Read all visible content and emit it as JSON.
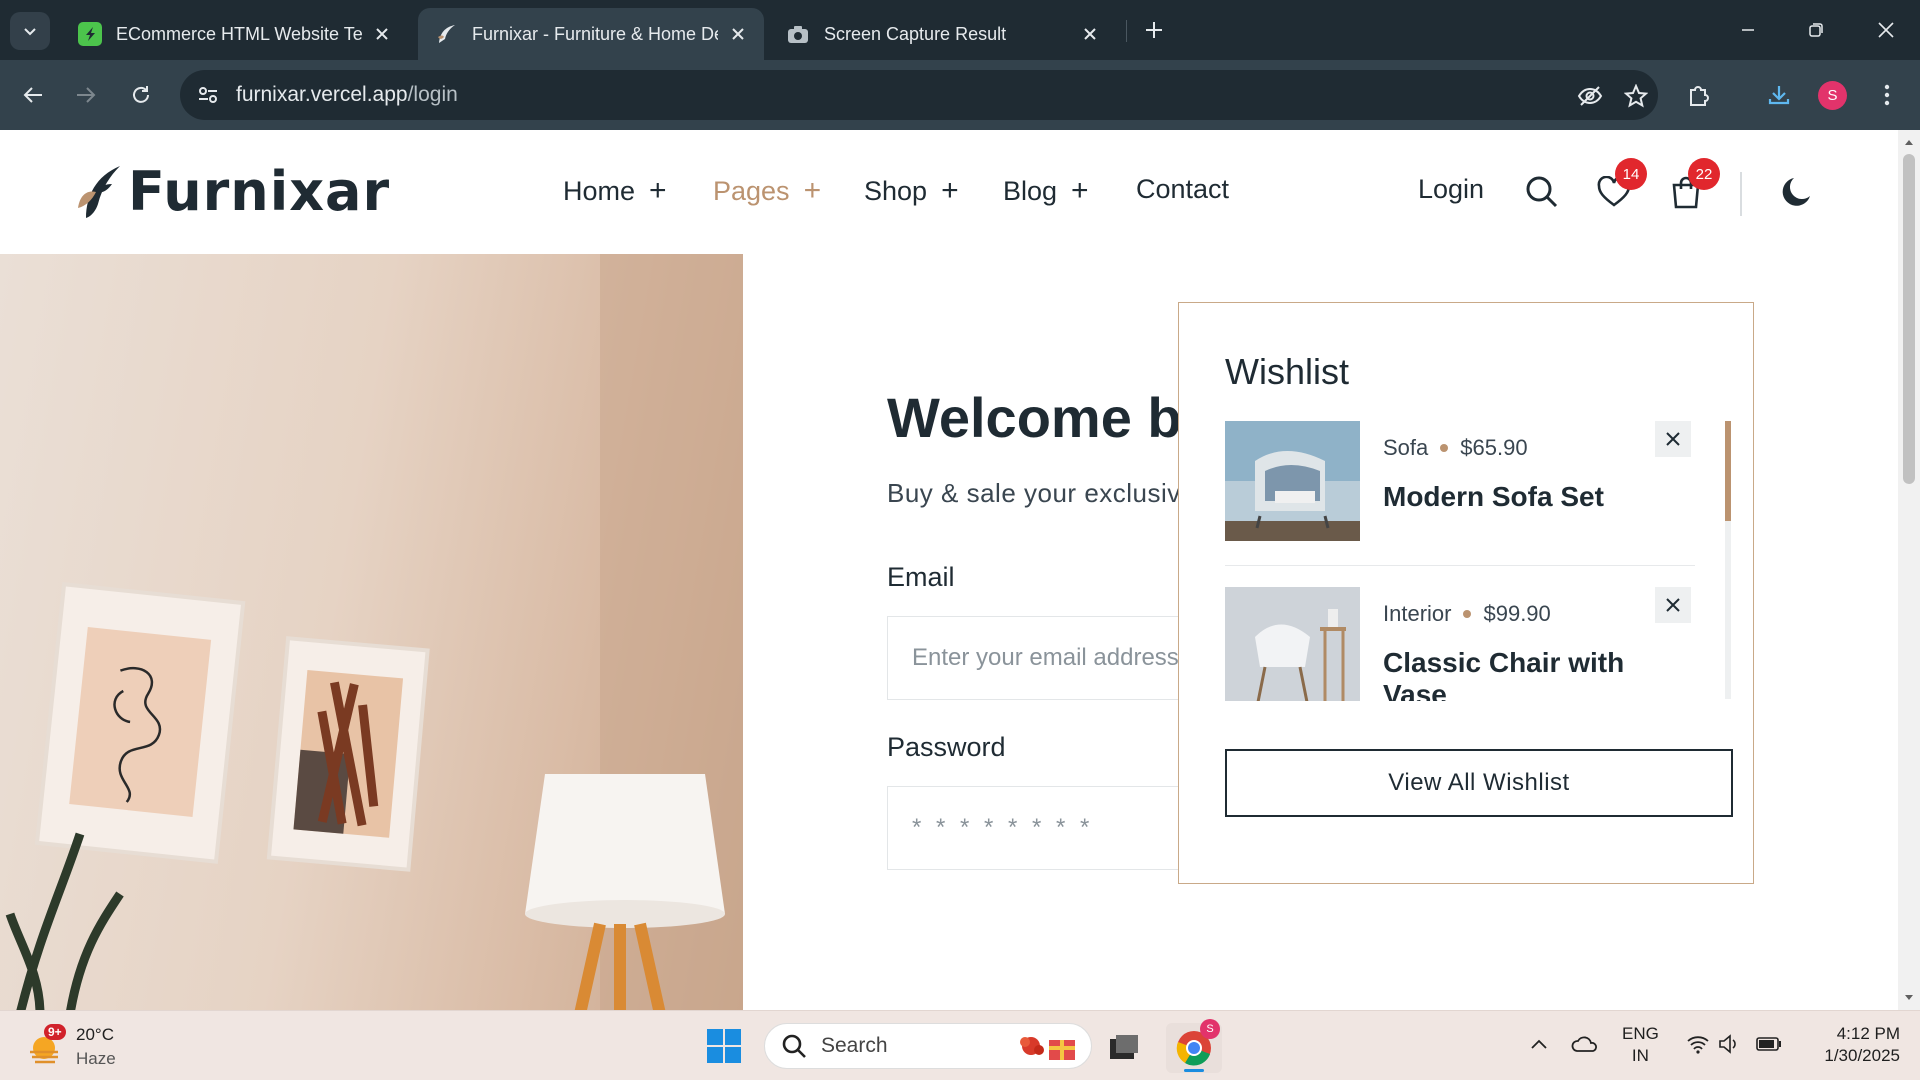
{
  "browser": {
    "tabs": [
      {
        "title": "ECommerce HTML Website Ten",
        "active": false
      },
      {
        "title": "Furnixar - Furniture & Home De",
        "active": true
      },
      {
        "title": "Screen Capture Result",
        "active": false
      }
    ],
    "url_host": "furnixar.vercel.app",
    "url_path": "/login",
    "profile_initial": "S"
  },
  "site": {
    "logo_text": "Furnixar",
    "nav": [
      {
        "label": "Home",
        "active": false
      },
      {
        "label": "Pages",
        "active": true
      },
      {
        "label": "Shop",
        "active": false
      },
      {
        "label": "Blog",
        "active": false
      },
      {
        "label": "Contact",
        "active": false
      }
    ],
    "nav_plus": "+",
    "login_label": "Login",
    "wishlist_count": "14",
    "cart_count": "22",
    "accent_color": "#bb9370",
    "dark_color": "#1f2b33",
    "badge_color": "#e1272d"
  },
  "login": {
    "heading": "Welcome back!",
    "subtext": "Buy & sale your exclusive product only on furnixar",
    "email_label": "Email",
    "email_placeholder": "Enter your email address",
    "password_label": "Password",
    "password_placeholder": "* * * * * * * *"
  },
  "wishlist": {
    "title": "Wishlist",
    "items": [
      {
        "category": "Sofa",
        "price": "$65.90",
        "name": "Modern Sofa Set"
      },
      {
        "category": "Interior",
        "price": "$99.90",
        "name": "Classic Chair with Vase"
      }
    ],
    "view_all_label": "View All Wishlist"
  },
  "taskbar": {
    "weather_temp": "20°C",
    "weather_cond": "Haze",
    "weather_badge": "9+",
    "search_label": "Search",
    "chrome_badge": "S",
    "lang_line1": "ENG",
    "lang_line2": "IN",
    "time": "4:12 PM",
    "date": "1/30/2025"
  }
}
